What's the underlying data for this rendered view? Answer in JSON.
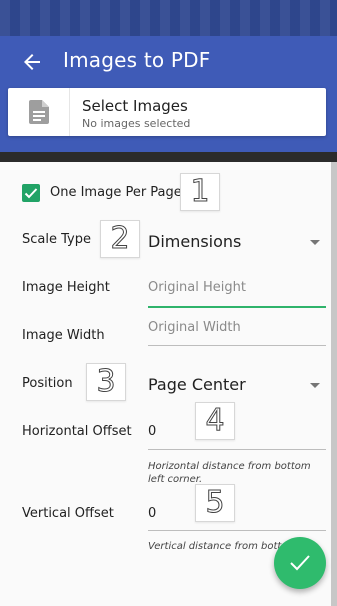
{
  "app": {
    "title": "Images to PDF"
  },
  "select_images": {
    "title": "Select Images",
    "subtitle": "No images selected"
  },
  "options": {
    "one_image_per_page": {
      "label": "One Image Per Page",
      "checked": true
    },
    "scale_type": {
      "label": "Scale Type",
      "value": "Dimensions"
    },
    "image_height": {
      "label": "Image Height",
      "placeholder": "Original Height"
    },
    "image_width": {
      "label": "Image Width",
      "placeholder": "Original Width"
    },
    "position": {
      "label": "Position",
      "value": "Page Center"
    },
    "horizontal_offset": {
      "label": "Horizontal Offset",
      "value": "0",
      "helper": "Horizontal distance from bottom left corner."
    },
    "vertical_offset": {
      "label": "Vertical Offset",
      "value": "0",
      "helper": "Vertical distance from bott corner."
    }
  },
  "annotations": [
    "1",
    "2",
    "3",
    "4",
    "5"
  ],
  "colors": {
    "appbar": "#3f5bb7",
    "accent": "#2fbb6d",
    "checkbox": "#21a366"
  },
  "icons": {
    "back": "arrow-left-icon",
    "document": "document-icon",
    "fab": "check-icon"
  }
}
